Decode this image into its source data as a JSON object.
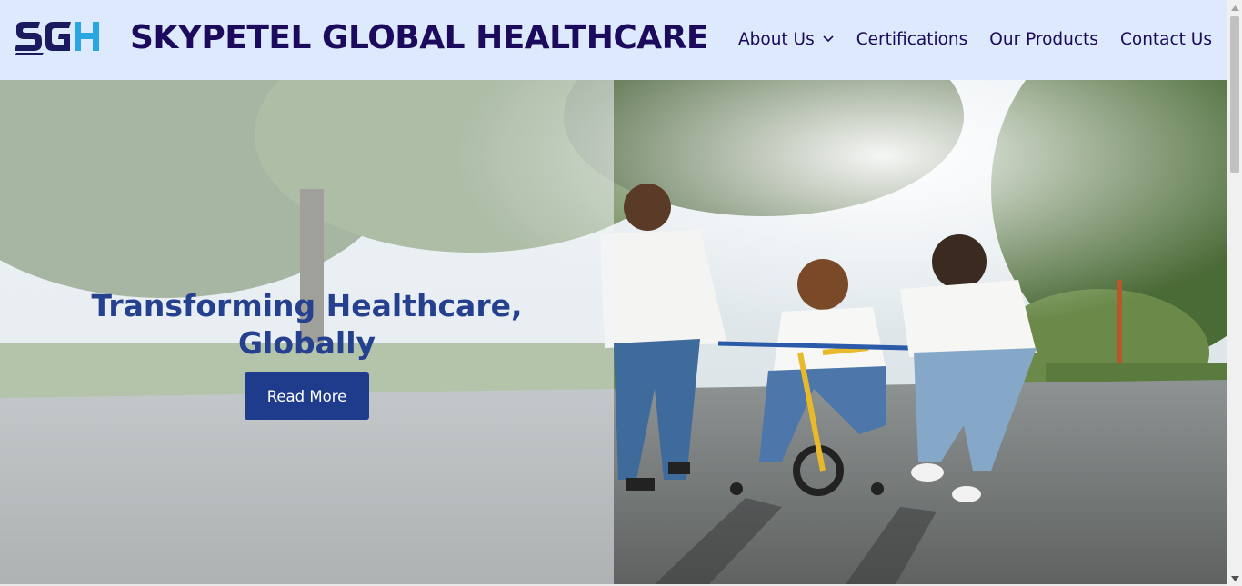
{
  "header": {
    "logo_text": "SGH",
    "brand": "SKYPETEL GLOBAL HEALTHCARE",
    "nav": [
      {
        "label": "About Us",
        "icon": "chevron-down-icon"
      },
      {
        "label": "Certifications"
      },
      {
        "label": "Our Products"
      },
      {
        "label": "Contact Us"
      }
    ]
  },
  "hero": {
    "title": "Transforming Healthcare, Globally",
    "button_label": "Read More",
    "image": "family-teaching-child-to-ride-bicycle-photo"
  },
  "colors": {
    "header_bg": "#dde9fd",
    "brand_text": "#1c0a5c",
    "hero_title": "#25408f",
    "button_bg": "#1f3c8c",
    "logo_dark": "#1c1a5e",
    "logo_light": "#2aa6e0"
  }
}
